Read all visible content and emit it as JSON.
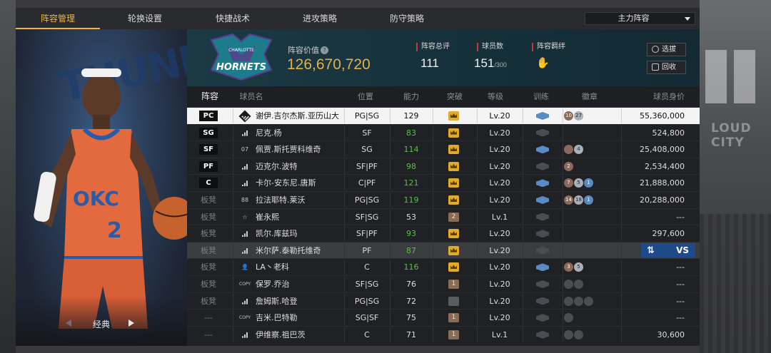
{
  "tabs": [
    "阵容管理",
    "轮换设置",
    "快捷战术",
    "进攻策略",
    "防守策略"
  ],
  "lineup_select": "主力阵容",
  "player_panel": {
    "style_label": "经典",
    "jersey_text": "OKC",
    "jersey_number": "2",
    "watermark": "THUNDER"
  },
  "team": {
    "logo_text_top": "CHARLOTTE",
    "logo_text_main": "HORNETS"
  },
  "header": {
    "value_label": "阵容价值",
    "value": "126,670,720",
    "stats": [
      {
        "label": "阵容总评",
        "value": "111",
        "sub": ""
      },
      {
        "label": "球员数",
        "value": "151",
        "sub": "/300"
      },
      {
        "label": "阵容羁绊",
        "value": "",
        "sub": ""
      }
    ],
    "buttons": [
      "选拔",
      "回收"
    ]
  },
  "table": {
    "columns": [
      "阵容",
      "球员名",
      "位置",
      "能力",
      "突破",
      "等级",
      "训练",
      "徽章",
      "球员身价"
    ],
    "rows": [
      {
        "slot": "PC",
        "starter": true,
        "jersey": "",
        "name": "谢伊.吉尔杰斯.亚历山大",
        "pos": "PG|SG",
        "ovr": "129",
        "ovr_green": false,
        "brk": "",
        "brk_type": "gold",
        "level": "Lv.20",
        "train": "blue",
        "medals": [
          [
            "10",
            "bronze"
          ],
          [
            "27",
            "silver"
          ]
        ],
        "salary": "55,360,000"
      },
      {
        "slot": "SG",
        "starter": true,
        "jersey": "",
        "name": "尼克.杨",
        "pos": "SF",
        "ovr": "83",
        "ovr_green": true,
        "brk": "",
        "brk_type": "gold",
        "level": "Lv.20",
        "train": "gray",
        "medals": [],
        "salary": "524,800"
      },
      {
        "slot": "SF",
        "starter": true,
        "jersey": "07",
        "name": "佩贾.斯托贾科维奇",
        "pos": "SG",
        "ovr": "114",
        "ovr_green": true,
        "brk": "",
        "brk_type": "gold",
        "level": "Lv.20",
        "train": "blue",
        "medals": [
          [
            "",
            "bronze"
          ],
          [
            "4",
            "silver"
          ]
        ],
        "salary": "25,408,000"
      },
      {
        "slot": "PF",
        "starter": true,
        "jersey": "",
        "name": "迈克尔.波特",
        "pos": "SF|PF",
        "ovr": "98",
        "ovr_green": true,
        "brk": "",
        "brk_type": "gold",
        "level": "Lv.20",
        "train": "gray",
        "medals": [
          [
            "2",
            "bronze"
          ]
        ],
        "salary": "2,534,400"
      },
      {
        "slot": "C",
        "starter": true,
        "jersey": "",
        "name": "卡尔-安东尼.唐斯",
        "pos": "C|PF",
        "ovr": "121",
        "ovr_green": true,
        "brk": "",
        "brk_type": "gold",
        "level": "Lv.20",
        "train": "blue",
        "medals": [
          [
            "7",
            "bronze"
          ],
          [
            "5",
            "silver"
          ],
          [
            "1",
            "blue"
          ]
        ],
        "salary": "21,888,000"
      },
      {
        "slot": "板凳",
        "starter": false,
        "jersey": "88",
        "name": "拉法耶特.莱沃",
        "pos": "PG|SG",
        "ovr": "119",
        "ovr_green": true,
        "brk": "",
        "brk_type": "gold",
        "level": "Lv.20",
        "train": "blue",
        "medals": [
          [
            "14",
            "bronze"
          ],
          [
            "18",
            "silver"
          ],
          [
            "1",
            "blue"
          ]
        ],
        "salary": "20,288,000"
      },
      {
        "slot": "板凳",
        "starter": false,
        "jersey": "☆",
        "name": "崔永熙",
        "pos": "SF|SG",
        "ovr": "53",
        "ovr_green": false,
        "brk": "2",
        "brk_type": "brown",
        "level": "Lv.1",
        "train": "gray",
        "medals": [],
        "salary": "---"
      },
      {
        "slot": "板凳",
        "starter": false,
        "jersey": "",
        "name": "凯尔.库兹玛",
        "pos": "SF|PF",
        "ovr": "93",
        "ovr_green": true,
        "brk": "",
        "brk_type": "gold",
        "level": "Lv.20",
        "train": "gray",
        "medals": [],
        "salary": "297,600"
      },
      {
        "slot": "板凳",
        "starter": false,
        "jersey": "",
        "name": "米尔萨.泰勒托维奇",
        "pos": "PF",
        "ovr": "87",
        "ovr_green": true,
        "brk": "",
        "brk_type": "gold",
        "level": "Lv.20",
        "train": "gray",
        "medals": [],
        "salary": "",
        "vs": "VS"
      },
      {
        "slot": "板凳",
        "starter": false,
        "jersey": "👤",
        "name": "LA丶老科",
        "pos": "C",
        "ovr": "116",
        "ovr_green": true,
        "brk": "",
        "brk_type": "gold",
        "level": "Lv.20",
        "train": "blue",
        "medals": [
          [
            "3",
            "bronze"
          ],
          [
            "5",
            "silver"
          ]
        ],
        "salary": "---"
      },
      {
        "slot": "板凳",
        "starter": false,
        "jersey": "COPY",
        "name": "保罗.乔治",
        "pos": "SF|SG",
        "ovr": "76",
        "ovr_green": false,
        "brk": "1",
        "brk_type": "brown",
        "level": "Lv.20",
        "train": "gray",
        "medals": [
          [
            "",
            "dark"
          ],
          [
            "",
            "dark"
          ]
        ],
        "salary": "---"
      },
      {
        "slot": "板凳",
        "starter": false,
        "jersey": "",
        "name": "詹姆斯.哈登",
        "pos": "PG|SG",
        "ovr": "72",
        "ovr_green": false,
        "brk": "",
        "brk_type": "gray",
        "level": "Lv.20",
        "train": "gray",
        "medals": [
          [
            "",
            "dark"
          ],
          [
            "",
            "dark"
          ],
          [
            "",
            "dark"
          ]
        ],
        "salary": "---"
      },
      {
        "slot": "---",
        "starter": false,
        "jersey": "COPY",
        "name": "吉米.巴特勒",
        "pos": "SG|SF",
        "ovr": "75",
        "ovr_green": false,
        "brk": "1",
        "brk_type": "brown",
        "level": "Lv.20",
        "train": "gray",
        "medals": [
          [
            "",
            "dark"
          ]
        ],
        "salary": "---"
      },
      {
        "slot": "---",
        "starter": false,
        "jersey": "",
        "name": "伊维察.祖巴茨",
        "pos": "C",
        "ovr": "71",
        "ovr_green": false,
        "brk": "1",
        "brk_type": "brown",
        "level": "Lv.1",
        "train": "gray",
        "medals": [
          [
            "",
            "dark"
          ],
          [
            "",
            "dark"
          ]
        ],
        "salary": "30,600"
      }
    ]
  },
  "colors": {
    "accent": "#e8b646",
    "value_gold": "#e3b04a",
    "green": "#5dbd4a",
    "vs_blue": "#1f4a8a"
  }
}
